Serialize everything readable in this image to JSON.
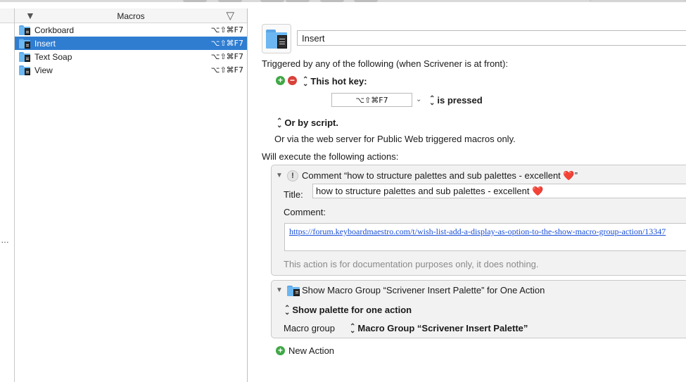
{
  "macro_list": {
    "header_title": "Macros",
    "header_left_icon": "sort-triangle-icon",
    "header_right_icon": "filter-triangle-icon",
    "items": [
      {
        "name": "Corkboard",
        "hotkey": "⌥⇧⌘F7",
        "selected": false
      },
      {
        "name": "Insert",
        "hotkey": "⌥⇧⌘F7",
        "selected": true
      },
      {
        "name": "Text Soap",
        "hotkey": "⌥⇧⌘F7",
        "selected": false
      },
      {
        "name": "View",
        "hotkey": "⌥⇧⌘F7",
        "selected": false
      }
    ]
  },
  "left_strip": {
    "ellipsis": "…"
  },
  "editor": {
    "macro_name": "Insert",
    "triggered_text": "Triggered by any of the following (when Scrivener is at front):",
    "hotkey_trigger_label": "This hot key:",
    "hotkey_value": "⌥⇧⌘F7",
    "is_pressed_label": "is pressed",
    "script_trigger_label": "Or by script.",
    "web_server_text": "Or via the web server for Public Web triggered macros only.",
    "will_execute_text": "Will execute the following actions:",
    "actions": {
      "comment": {
        "header": "Comment “how to structure palettes and sub palettes - excellent ",
        "header_heart": "❤️",
        "header_end": "”",
        "title_label": "Title:",
        "title_value": "how to structure palettes and sub palettes - excellent ",
        "title_heart": "❤️",
        "comment_label": "Comment:",
        "comment_link": "https://forum.keyboardmaestro.com/t/wish-list-add-a-display-as-option-to-the-show-macro-group-action/13347",
        "note": "This action is for documentation purposes only, it does nothing."
      },
      "show_group": {
        "header": "Show Macro Group “Scrivener Insert Palette” for One Action",
        "mode_label": "Show palette for one action",
        "group_label": "Macro group",
        "group_value": "Macro Group “Scrivener Insert Palette”"
      }
    },
    "new_action_label": "New Action"
  },
  "colors": {
    "selection": "#2f7dd1",
    "add_green": "#3fa845",
    "remove_red": "#d8413a",
    "link_blue": "#1a4fd6"
  }
}
